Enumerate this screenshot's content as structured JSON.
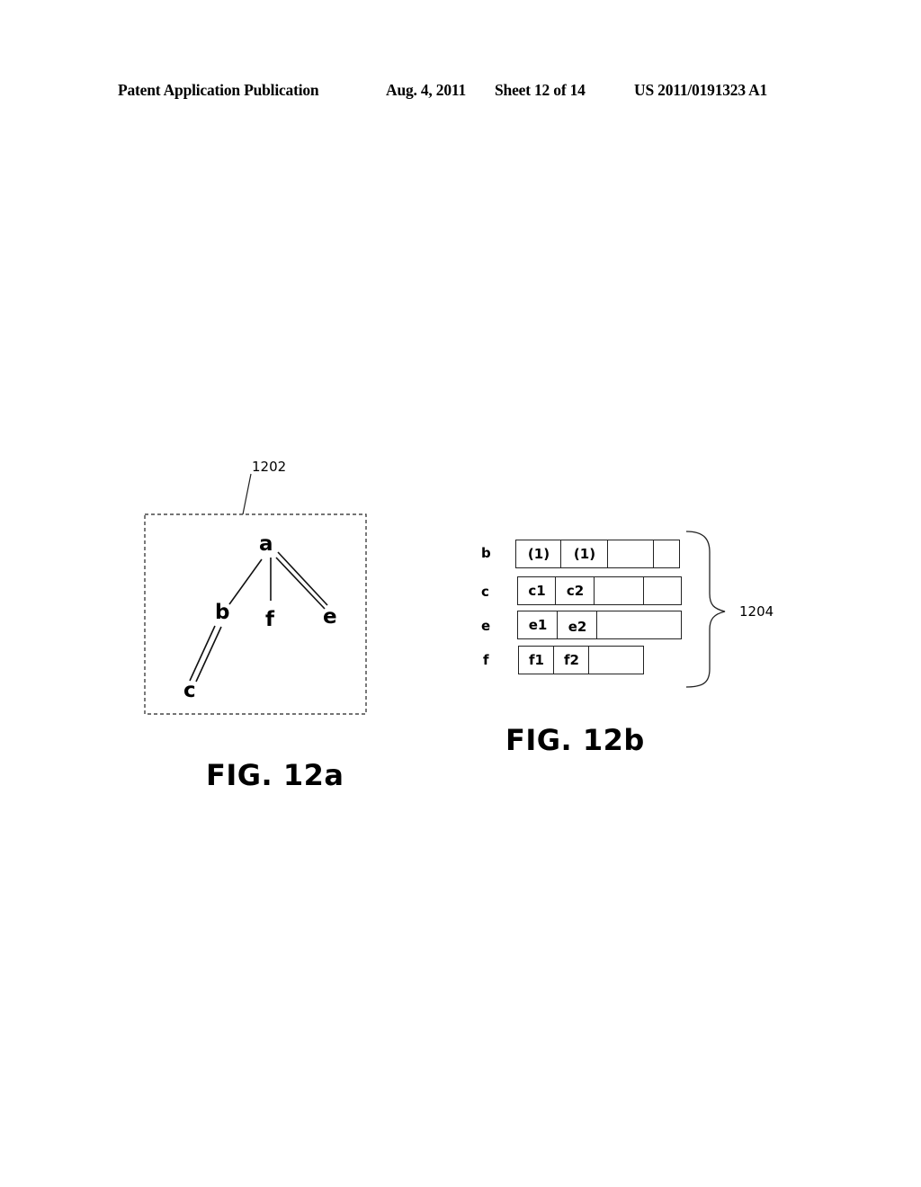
{
  "header": {
    "publication": "Patent Application Publication",
    "date": "Aug. 4, 2011",
    "sheet": "Sheet 12 of 14",
    "number": "US 2011/0191323 A1"
  },
  "fig12a": {
    "ref_label": "1202",
    "caption": "FIG. 12a",
    "nodes": {
      "a": "a",
      "b": "b",
      "c": "c",
      "e": "e",
      "f": "f"
    },
    "edges": [
      {
        "from": "a",
        "to": "b",
        "style": "single"
      },
      {
        "from": "a",
        "to": "f",
        "style": "single"
      },
      {
        "from": "a",
        "to": "e",
        "style": "double"
      },
      {
        "from": "b",
        "to": "c",
        "style": "double"
      }
    ]
  },
  "fig12b": {
    "ref_label": "1204",
    "caption": "FIG. 12b",
    "rows": [
      {
        "label": "b",
        "cells": [
          "(1)",
          "(1)",
          "",
          ""
        ]
      },
      {
        "label": "c",
        "cells": [
          "c1",
          "c2",
          "",
          ""
        ]
      },
      {
        "label": "e",
        "cells": [
          "e1",
          "e2",
          ""
        ]
      },
      {
        "label": "f",
        "cells": [
          "f1",
          "f2",
          ""
        ]
      }
    ]
  }
}
